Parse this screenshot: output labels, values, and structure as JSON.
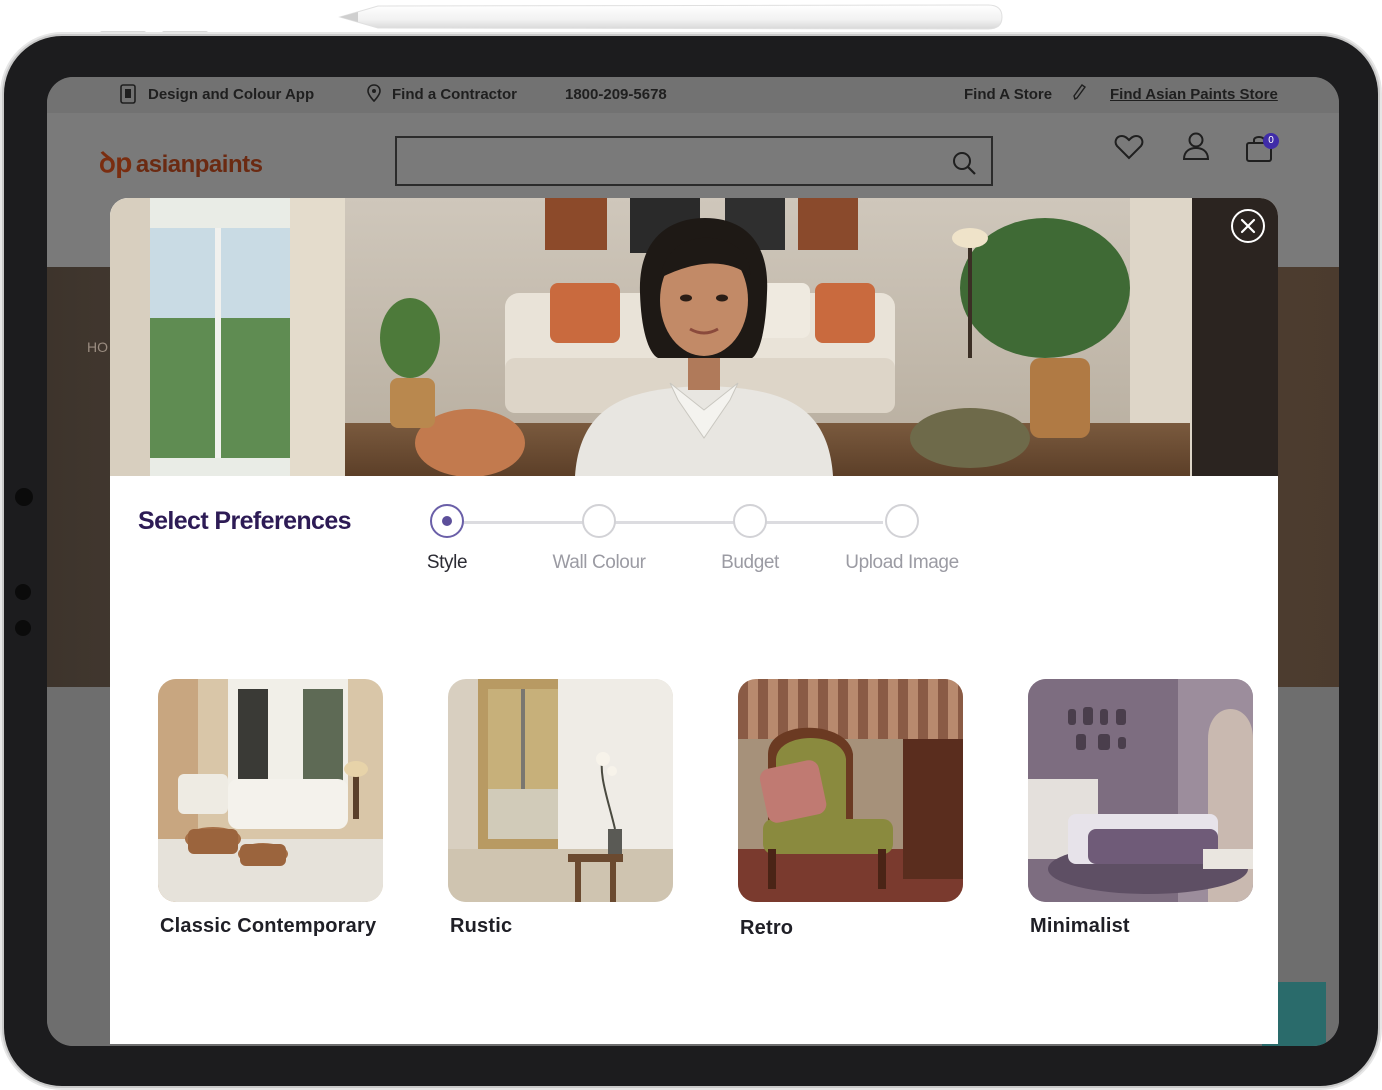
{
  "topbar": {
    "design_app": "Design and Colour App",
    "find_contractor": "Find a Contractor",
    "phone": "1800-209-5678",
    "find_store": "Find A Store",
    "find_ap_store": "Find Asian Paints Store"
  },
  "header": {
    "logo_text": "asianpaints",
    "cart_count": "0"
  },
  "hero": {
    "hint": "HO"
  },
  "modal": {
    "title": "Select Preferences",
    "steps": [
      {
        "label": "Style",
        "active": true
      },
      {
        "label": "Wall Colour",
        "active": false
      },
      {
        "label": "Budget",
        "active": false
      },
      {
        "label": "Upload Image",
        "active": false
      }
    ],
    "styles": [
      {
        "label": "Classic Contemporary"
      },
      {
        "label": "Rustic"
      },
      {
        "label": "Retro"
      },
      {
        "label": "Minimalist"
      }
    ]
  },
  "colors": {
    "title": "#2d1b55",
    "step_active": "#5c4f9a",
    "overlay": "#6d6d6d"
  },
  "icons": [
    "phone-app-icon",
    "location-pin-icon",
    "pencil-icon",
    "search-icon",
    "heart-icon",
    "user-icon",
    "cart-icon",
    "close-icon"
  ]
}
